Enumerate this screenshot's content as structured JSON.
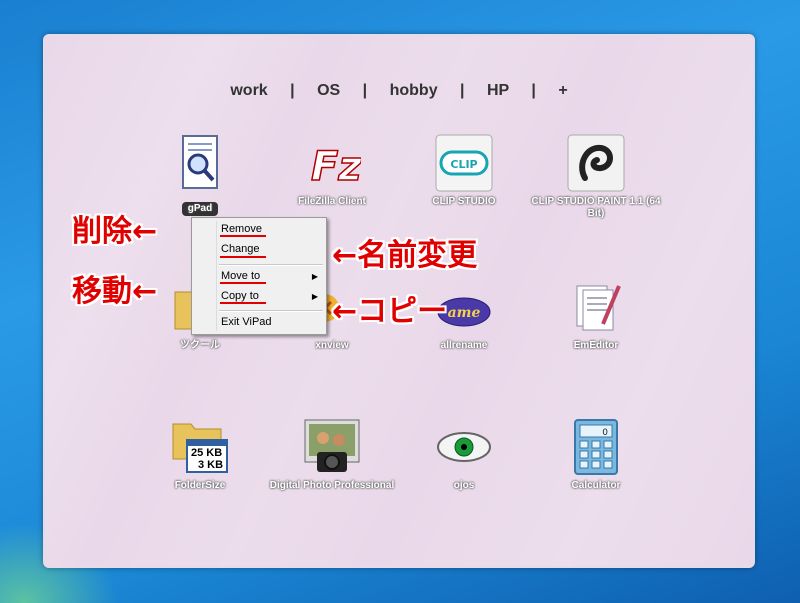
{
  "tabs": [
    "work",
    "OS",
    "hobby",
    "HP",
    "+"
  ],
  "tab_separator": "|",
  "icons": [
    {
      "label": "gPad",
      "icon": "notepad-magnifier-icon"
    },
    {
      "label": "FileZilla Client",
      "icon": "filezilla-icon"
    },
    {
      "label": "CLIP STUDIO",
      "icon": "clip-studio-icon"
    },
    {
      "label": "CLIP STUDIO PAINT 1.1 (64 Bit)",
      "icon": "clip-studio-paint-icon"
    },
    {
      "label": "ツクール",
      "icon": "folder-icon"
    },
    {
      "label": "xnview",
      "icon": "xnview-icon"
    },
    {
      "label": "allrename",
      "icon": "allrename-icon"
    },
    {
      "label": "EmEditor",
      "icon": "emeditor-icon"
    },
    {
      "label": "FolderSize",
      "icon": "foldersize-icon"
    },
    {
      "label": "Digital Photo Professional",
      "icon": "digital-photo-professional-icon"
    },
    {
      "label": "ojos",
      "icon": "eye-icon"
    },
    {
      "label": "Calculator",
      "icon": "calculator-icon"
    }
  ],
  "foldersize_text": {
    "line1": "25 KB",
    "line2": "3 KB"
  },
  "context_menu": {
    "remove": "Remove",
    "change": "Change",
    "move_to": "Move to",
    "copy_to": "Copy to",
    "exit": "Exit  ViPad",
    "submenu_arrow": "▶"
  },
  "annotations": {
    "delete": "削除←",
    "rename": "←名前変更",
    "move": "移動←",
    "copy": "←コピー"
  },
  "colors": {
    "annotation": "#e00000",
    "panel": "#e9d8e9",
    "desktop": "#1a86d4"
  }
}
